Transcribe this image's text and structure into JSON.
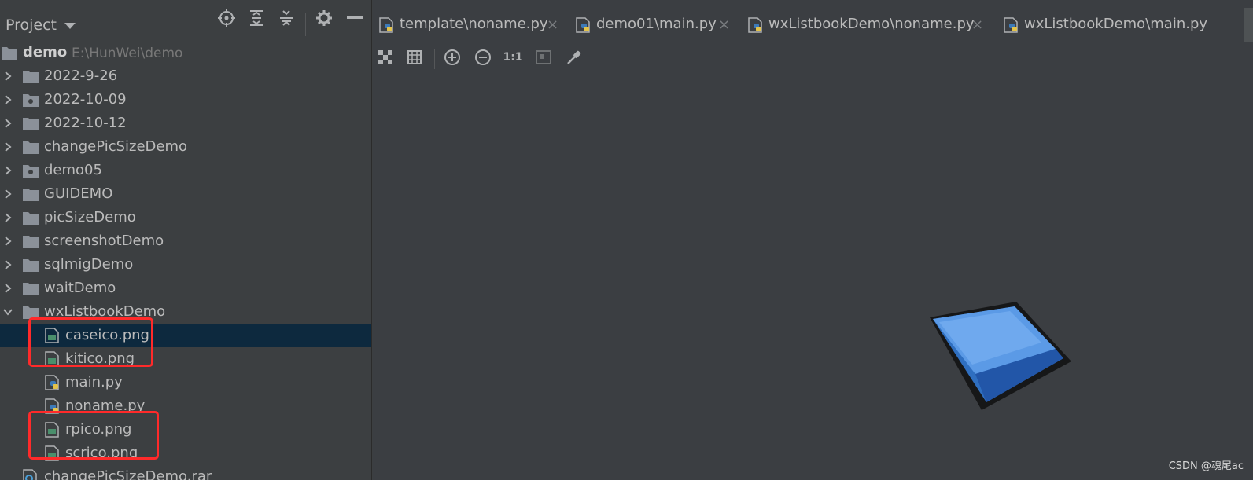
{
  "panel": {
    "title": "Project"
  },
  "tree": {
    "root": {
      "label": "demo",
      "path": "E:\\HunWei\\demo"
    },
    "folders": [
      {
        "label": "2022-9-26"
      },
      {
        "label": "2022-10-09"
      },
      {
        "label": "2022-10-12"
      },
      {
        "label": "changePicSizeDemo"
      },
      {
        "label": "demo05"
      },
      {
        "label": "GUIDEMO"
      },
      {
        "label": "picSizeDemo"
      },
      {
        "label": "screenshotDemo"
      },
      {
        "label": "sqlmigDemo"
      },
      {
        "label": "waitDemo"
      },
      {
        "label": "wxListbookDemo"
      }
    ],
    "files": [
      {
        "label": "caseico.png"
      },
      {
        "label": "kitico.png"
      },
      {
        "label": "main.py"
      },
      {
        "label": "noname.py"
      },
      {
        "label": "rpico.png"
      },
      {
        "label": "scrico.png"
      }
    ],
    "trailing": {
      "label": "changePicSizeDemo.rar"
    }
  },
  "tabs": [
    {
      "label": "template\\noname.py",
      "close": "×"
    },
    {
      "label": "demo01\\main.py",
      "close": "×"
    },
    {
      "label": "wxListbookDemo\\noname.py",
      "close": "×"
    },
    {
      "label": "wxListbookDemo\\main.py"
    }
  ],
  "toolbar": {
    "actual_size_label": "1:1"
  },
  "watermark": "CSDN @魂尾ac",
  "colors": {
    "selection": "#0d293e",
    "highlight_box": "#ff2a2a",
    "folder": "#8b9199",
    "preview_blue": "#4f8fd8"
  }
}
